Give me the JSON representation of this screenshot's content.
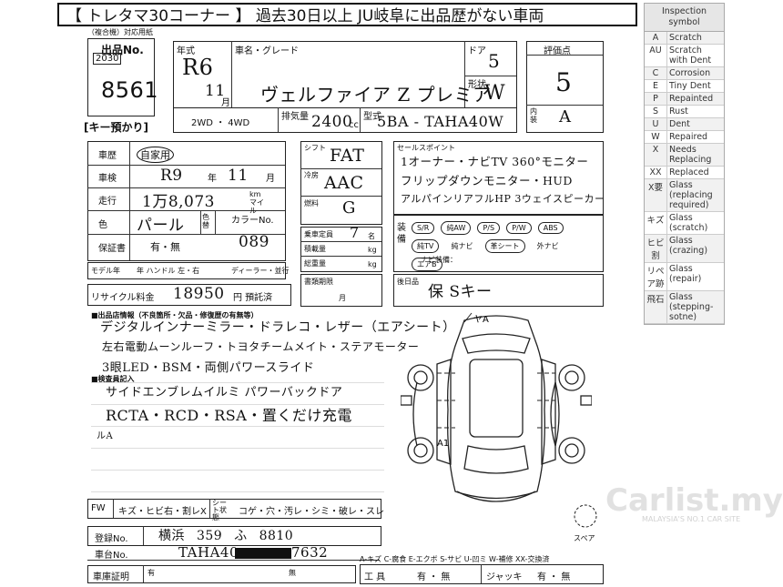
{
  "header": {
    "title": "【 トレタマ30コーナー 】 過去30日以上 JU岐阜に出品歴がない車両"
  },
  "sheet": {
    "sub_caption": "（複合機）対応用紙",
    "lot_label": "出品No.",
    "lot_prefix": "2030",
    "lot_number": "8561",
    "key_label": "[キー預かり]",
    "year_label": "年式",
    "year_value": "R6",
    "month_value": "11",
    "month_unit": "月",
    "name_label": "車名・グレード",
    "name_value": "ヴェルファイア Z プレミア",
    "doors_label": "ドア",
    "doors_value": "5",
    "body_label": "形状",
    "body_value": "W",
    "drive_label": "2WD ・ 4WD",
    "cc_label": "排気量",
    "cc_value": "2400",
    "cc_unit": "cc",
    "model_label": "型式",
    "model_value": "5BA - TAHA40W",
    "score_label": "評価点",
    "score_value": "5",
    "interior_label": "内装",
    "interior_value": "A",
    "history_label": "車歴",
    "history_value": "自家用",
    "inspection_label": "車検",
    "inspection_value": "R9",
    "inspection_year_unit": "年",
    "inspection_month": "11",
    "inspection_month_unit": "月",
    "mileage_label": "走行",
    "mileage_value": "1万8,073",
    "mileage_unit": "km マイル",
    "color_label": "色",
    "color_value": "パール",
    "color_change_label": "色替",
    "color_no_label": "カラーNo.",
    "color_no_value": "089",
    "warranty_label": "保証書",
    "warranty_value": "有・無",
    "model_year_label": "モデル年",
    "handle_label": "年  ハンドル 左・右",
    "dealer_label": "ディーラー・並行",
    "shift_label": "シフト",
    "shift_value": "FAT",
    "ac_label": "冷房",
    "ac_value": "AAC",
    "fuel_label": "燃料",
    "fuel_value": "G",
    "seats_label": "乗車定員",
    "seats_value": "7",
    "seats_unit": "名",
    "load_label": "積載量",
    "load_unit": "kg",
    "gross_label": "総重量",
    "gross_unit": "kg",
    "doc_label": "書類期限",
    "doc_unit": "月",
    "recycle_label": "リサイクル料金",
    "recycle_value": "18950",
    "recycle_unit": "円 預託済",
    "points_label": "セールスポイント",
    "points_lines": [
      "1オーナー・ナビTV 360°モニター",
      "フリップダウンモニター・HUD",
      "アルパインリアフルHP 3ウェイスピーカー"
    ],
    "equip_label": "装備",
    "equip_options": [
      "S/R",
      "純AW",
      "P/S",
      "P/W",
      "ABS",
      "純TV",
      "純ナビ",
      "革シート",
      "外ナビ",
      "エアB"
    ],
    "navi_label": "ナビ装備：",
    "post_label": "後日品",
    "post_value": "保 Sキー",
    "notes_label": "■出品店情報（不良箇所・欠品・修復歴の有無等）",
    "notes_lines": [
      "デジタルインナーミラー・ドラレコ・レザー（エアシート）",
      "左右電動ムーンルーフ・トヨタチームメイト・ステアモーター",
      "3眼LED・BSM・両側パワースライド"
    ],
    "inspector_label": "■検査員記入",
    "inspector_lines": [
      "サイドエンブレムイルミ  パワーバックドア",
      "RCTA・RCD・RSA・置くだけ充電",
      "ルA"
    ],
    "diagram_label_ya": "ヤA",
    "diagram_label_a1": "A1",
    "spare_label": "スペア",
    "fw_label": "FW",
    "fw_defects": "キズ・ヒビ右・割レX",
    "seat_label": "シート状態",
    "seat_defects": "コゲ・穴・汚レ・シミ・破レ・スレ",
    "reg_label": "登録No.",
    "reg_value": "横浜 359 ふ 8810",
    "chassis_label": "車台No.",
    "chassis_value": "TAHA40-",
    "chassis_tail": "7632",
    "cert_label": "車庫証明",
    "cert_yes": "有",
    "cert_no": "無",
    "tools_label": "工 具",
    "tools_value": "有 ・ 無",
    "jack_label": "ジャッキ",
    "jack_value": "有 ・ 無",
    "abbrev": "A-キズ C-腐食 E-エクボ S-サビ U-凹ミ W-補修 XX-交換済"
  },
  "legend": {
    "title": "Inspection symbol",
    "rows": [
      {
        "k": "A",
        "v": "Scratch"
      },
      {
        "k": "AU",
        "v": "Scratch with Dent"
      },
      {
        "k": "C",
        "v": "Corrosion"
      },
      {
        "k": "E",
        "v": "Tiny Dent"
      },
      {
        "k": "P",
        "v": "Repainted"
      },
      {
        "k": "S",
        "v": "Rust"
      },
      {
        "k": "U",
        "v": "Dent"
      },
      {
        "k": "W",
        "v": "Repaired"
      },
      {
        "k": "X",
        "v": "Needs Replacing"
      },
      {
        "k": "XX",
        "v": "Replaced"
      },
      {
        "k": "X要",
        "v": "Glass (replacing required)"
      },
      {
        "k": "キズ",
        "v": "Glass (scratch)"
      },
      {
        "k": "ヒビ割",
        "v": "Glass (crazing)"
      },
      {
        "k": "リペア跡",
        "v": "Glass (repair)"
      },
      {
        "k": "飛石",
        "v": "Glass (stepping-sotne)"
      }
    ]
  },
  "watermark": {
    "brand": "Carlist.my",
    "tagline": "MALAYSIA'S NO.1 CAR SITE"
  }
}
